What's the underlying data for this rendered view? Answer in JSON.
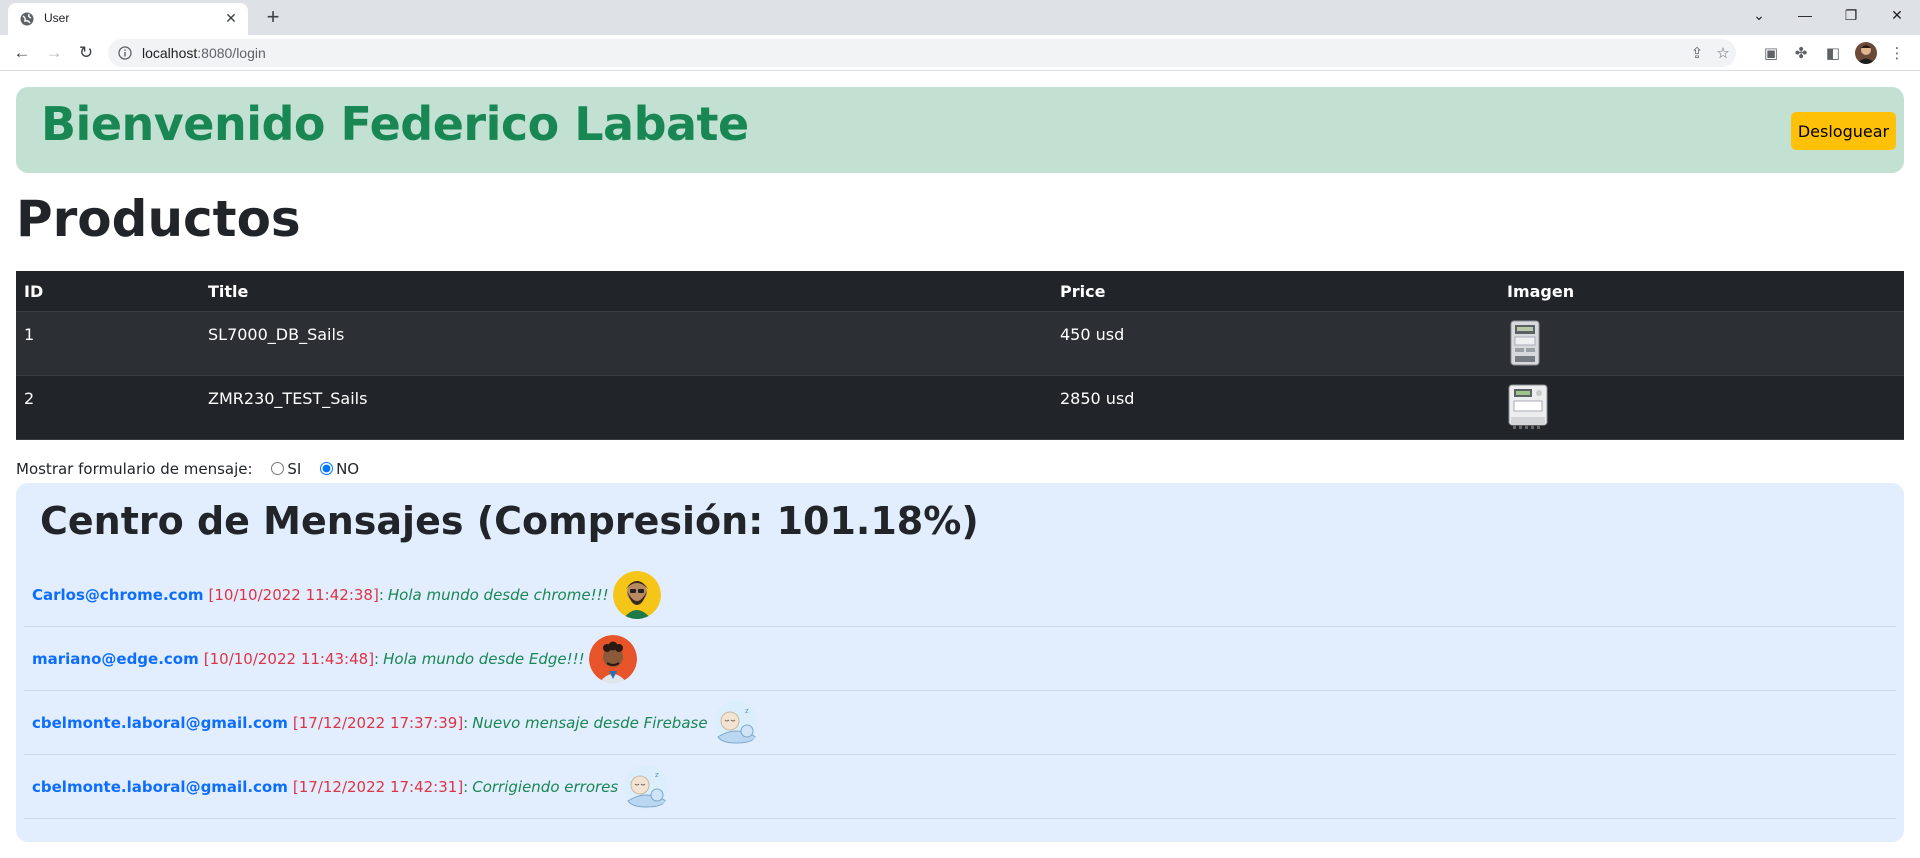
{
  "browser": {
    "tab_title": "User",
    "url_host": "localhost",
    "url_path": ":8080/login",
    "newtab_label": "+",
    "minimize_label": "—",
    "restore_label": "❐",
    "close_label": "✕"
  },
  "header": {
    "welcome_text": "Bienvenido Federico Labate",
    "logout_label": "Desloguear"
  },
  "products": {
    "title": "Productos",
    "columns": [
      "ID",
      "Title",
      "Price",
      "Imagen"
    ],
    "rows": [
      {
        "id": "1",
        "title": "SL7000_DB_Sails",
        "price": "450 usd"
      },
      {
        "id": "2",
        "title": "ZMR230_TEST_Sails",
        "price": "2850 usd"
      }
    ]
  },
  "message_toggle": {
    "label": "Mostrar formulario de mensaje:",
    "option_yes": "SI",
    "option_no": "NO",
    "selected": "NO"
  },
  "messages": {
    "title": "Centro de Mensajes (Compresión: 101.18%)",
    "items": [
      {
        "email": "Carlos@chrome.com",
        "time": "[10/10/2022 11:42:38]",
        "sep": ":",
        "text": "Hola mundo desde chrome!!!",
        "avatar_color": "#f5c518"
      },
      {
        "email": "mariano@edge.com",
        "time": "[10/10/2022 11:43:48]",
        "sep": ":",
        "text": "Hola mundo desde Edge!!!",
        "avatar_color": "#e8542a"
      },
      {
        "email": "cbelmonte.laboral@gmail.com",
        "time": "[17/12/2022 17:37:39]",
        "sep": ":",
        "text": "Nuevo mensaje desde Firebase",
        "avatar_color": "#dbeefc"
      },
      {
        "email": "cbelmonte.laboral@gmail.com",
        "time": "[17/12/2022 17:42:31]",
        "sep": ":",
        "text": "Corrigiendo errores",
        "avatar_color": "#dbeefc"
      }
    ]
  },
  "colors": {
    "welcome_bg": "#c3e1d2",
    "welcome_text": "#198754",
    "logout_bg": "#ffc107",
    "table_bg": "#212529",
    "msg_bg": "#e2edfd",
    "email": "#0d6efd",
    "time": "#dc3545"
  }
}
